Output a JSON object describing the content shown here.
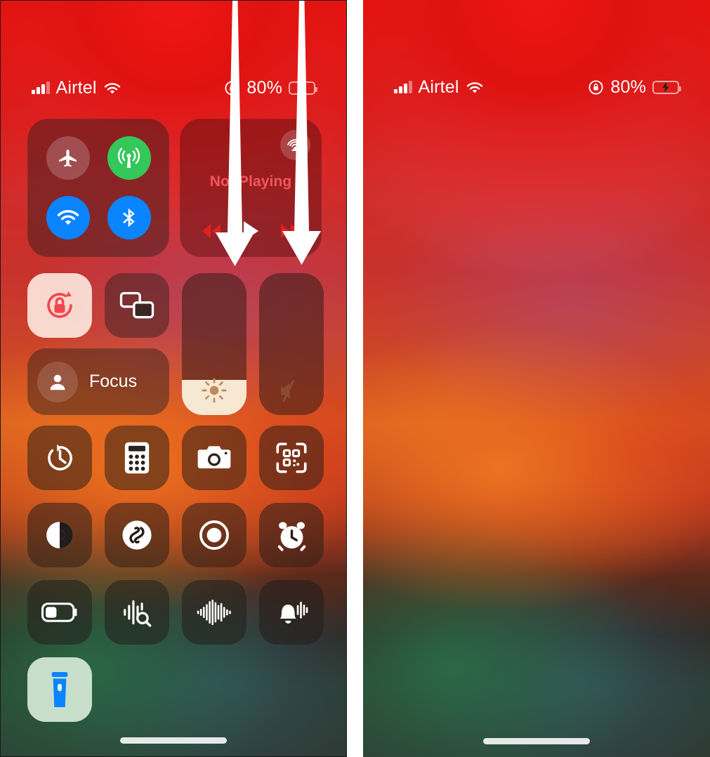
{
  "screenshot": {
    "description": "Two side-by-side iPhone Control Center screenshots with white down-arrow annotations on the left panel",
    "panel_count": 2
  },
  "status_bar": {
    "carrier": "Airtel",
    "signal_icon": "cellular-bars-icon",
    "signal_bars_filled": 3,
    "signal_bars_total": 4,
    "wifi_icon": "wifi-icon",
    "rotation_lock_icon": "rotation-lock-status-icon",
    "battery_percent": "80%",
    "battery_fill": 82,
    "battery_charging": true,
    "battery_color": "#32d74b"
  },
  "connectivity": {
    "name": "connectivity-module",
    "airplane": {
      "label": "Airplane Mode",
      "icon": "airplane-icon",
      "state": "off",
      "color": "#6e6a6c"
    },
    "cellular": {
      "label": "Cellular Data",
      "icon": "cellular-antenna-icon",
      "state": "on",
      "color": "#34c759"
    },
    "wifi": {
      "label": "Wi-Fi",
      "icon": "wifi-icon",
      "state": "on",
      "color": "#0a84ff"
    },
    "bluetooth": {
      "label": "Bluetooth",
      "icon": "bluetooth-icon",
      "state": "on",
      "color": "#0a84ff"
    }
  },
  "media": {
    "name": "now-playing-module",
    "title": "Not Playing",
    "title_color": "#f2555f",
    "airplay_icon": "airplay-icon",
    "rewind_icon": "rewind-icon",
    "play_icon": "play-icon",
    "forward_icon": "fast-forward-icon",
    "control_color": "#e0211f",
    "play_color": "#ffffff"
  },
  "rotation_lock": {
    "name": "rotation-lock-toggle",
    "label": "Portrait Orientation Lock",
    "icon": "rotation-lock-icon",
    "state": "on",
    "icon_color": "#f2474f",
    "background": "#ffeee4"
  },
  "screen_mirroring": {
    "name": "screen-mirroring-toggle",
    "label": "Screen Mirroring",
    "icon": "screen-mirroring-icon",
    "state": "off"
  },
  "focus": {
    "name": "focus-module",
    "label": "Focus",
    "icon": "person-icon",
    "state": "off"
  },
  "brightness": {
    "name": "brightness-slider",
    "label": "Brightness",
    "icon": "brightness-sun-icon",
    "value_percent": 25
  },
  "volume": {
    "name": "volume-slider",
    "label": "Volume",
    "icon": "speaker-mute-icon",
    "value_percent": 0,
    "muted": true
  },
  "toggle_rows": [
    [
      {
        "name": "timer-toggle",
        "label": "Timer",
        "icon": "timer-icon",
        "state": "off"
      },
      {
        "name": "calculator-toggle",
        "label": "Calculator",
        "icon": "calculator-icon",
        "state": "off"
      },
      {
        "name": "camera-toggle",
        "label": "Camera",
        "icon": "camera-icon",
        "state": "off"
      },
      {
        "name": "qr-scanner-toggle",
        "label": "Code Scanner",
        "icon": "qr-code-icon",
        "state": "off"
      }
    ],
    [
      {
        "name": "dark-mode-toggle",
        "label": "Dark Mode",
        "icon": "dark-mode-icon",
        "state": "off"
      },
      {
        "name": "shazam-toggle",
        "label": "Music Recognition",
        "icon": "shazam-icon",
        "state": "off"
      },
      {
        "name": "screen-record-toggle",
        "label": "Screen Recording",
        "icon": "screen-record-icon",
        "state": "off"
      },
      {
        "name": "alarm-toggle",
        "label": "Alarm",
        "icon": "alarm-clock-icon",
        "state": "off"
      }
    ],
    [
      {
        "name": "low-power-toggle",
        "label": "Low Power Mode",
        "icon": "low-power-battery-icon",
        "state": "off"
      },
      {
        "name": "sound-recognition-toggle",
        "label": "Sound Recognition",
        "icon": "sound-recognition-icon",
        "state": "off"
      },
      {
        "name": "voice-memos-toggle",
        "label": "Voice Memos",
        "icon": "waveform-icon",
        "state": "off"
      },
      {
        "name": "live-speech-toggle",
        "label": "Announce Notifications",
        "icon": "bell-waveform-icon",
        "state": "off"
      }
    ]
  ],
  "flashlight_left": {
    "name": "flashlight-toggle",
    "label": "Flashlight",
    "icon": "flashlight-icon",
    "state": "on",
    "icon_color": "#0a84ff",
    "background": "#e2f4e2"
  },
  "flashlight_right": {
    "name": "flashlight-toggle",
    "label": "Flashlight",
    "icon": "flashlight-icon",
    "state": "off",
    "icon_color": "#ffffff",
    "background": "#1f3a22"
  },
  "annotations": {
    "arrow_color": "#ffffff",
    "arrows": [
      {
        "name": "swipe-down-arrow-1",
        "direction": "down"
      },
      {
        "name": "swipe-down-arrow-2",
        "direction": "down"
      }
    ]
  },
  "home_indicator": {
    "name": "home-indicator",
    "color": "#ffffff"
  }
}
